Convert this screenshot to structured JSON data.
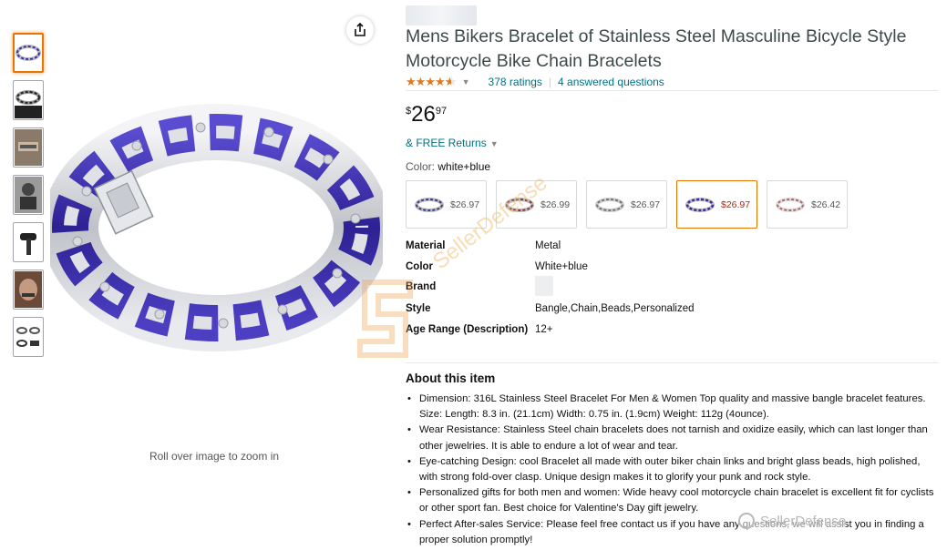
{
  "product": {
    "title": "Mens Bikers Bracelet of Stainless Steel Masculine Bicycle Style Motorcycle Bike Chain Bracelets",
    "rating_value": 4.5,
    "ratings_count": "378 ratings",
    "answered_questions": "4 answered questions",
    "price_symbol": "$",
    "price_whole": "26",
    "price_fraction": "97",
    "returns": "& FREE Returns",
    "color_label": "Color:",
    "color_value": "white+blue",
    "zoom_hint": "Roll over image to zoom in"
  },
  "thumbnails": [
    {
      "name": "bracelet-purple",
      "active": true
    },
    {
      "name": "bracelet-black",
      "active": false
    },
    {
      "name": "wrist-photo",
      "active": false
    },
    {
      "name": "rider-photo",
      "active": false
    },
    {
      "name": "motorcycle-handle",
      "active": false
    },
    {
      "name": "hand-photo",
      "active": false
    },
    {
      "name": "variants-collage",
      "active": false
    }
  ],
  "variants": [
    {
      "price": "$26.97",
      "selected": false,
      "accent": "#3a3f8a"
    },
    {
      "price": "$26.99",
      "selected": false,
      "accent": "#8a3a3a"
    },
    {
      "price": "$26.97",
      "selected": false,
      "accent": "#777777"
    },
    {
      "price": "$26.97",
      "selected": true,
      "accent": "#3b2f9e"
    },
    {
      "price": "$26.42",
      "selected": false,
      "accent": "#b06a6a"
    }
  ],
  "attributes": [
    {
      "key": "Material",
      "value": "Metal"
    },
    {
      "key": "Color",
      "value": "White+blue"
    },
    {
      "key": "Brand",
      "value": ""
    },
    {
      "key": "Style",
      "value": "Bangle,Chain,Beads,Personalized"
    },
    {
      "key": "Age Range (Description)",
      "value": "12+"
    }
  ],
  "about": {
    "title": "About this item",
    "bullets": [
      "Dimension: 316L Stainless Steel Bracelet For Men & Women Top quality and massive bangle bracelet features. Size: Length: 8.3 in. (21.1cm) Width: 0.75 in. (1.9cm) Weight: 112g (4ounce).",
      "Wear Resistance: Stainless Steel chain bracelets does not tarnish and oxidize easily, which can last longer than other jewelries. It is able to endure a lot of wear and tear.",
      "Eye-catching Design: cool Bracelet all made with outer biker chain links and bright glass beads, high polished, with strong fold-over clasp. Unique design makes it to glorify your punk and rock style.",
      "Personalized gifts for both men and women: Wide heavy cool motorcycle chain bracelet is excellent fit for cyclists or other sport fan. Best choice for Valentine's Day gift jewelry.",
      "Perfect After-sales Service: Please feel free contact us if you have any questions, we will assist you in finding a proper solution promptly!"
    ]
  },
  "watermark": {
    "text": "SellerDefense",
    "bottom_text": "SellerDefense"
  },
  "colors": {
    "link": "#007185",
    "star": "#de7921",
    "selected_border": "#e77600",
    "chain_purple": "#3b2fa8"
  }
}
